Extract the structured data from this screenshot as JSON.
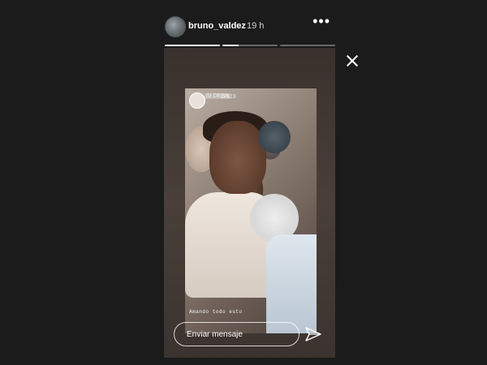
{
  "header": {
    "username": "bruno_valdez",
    "time": "19 h",
    "more_icon": "more-dots-icon"
  },
  "progress": {
    "segments": [
      1,
      0.3,
      0
    ]
  },
  "story": {
    "tag_logo": "SI\nDESA",
    "tag_text": "12323",
    "caption": "Amando todo esto"
  },
  "reply": {
    "placeholder": "Enviar mensaje",
    "send_icon": "send-icon"
  },
  "close_icon": "close-icon"
}
